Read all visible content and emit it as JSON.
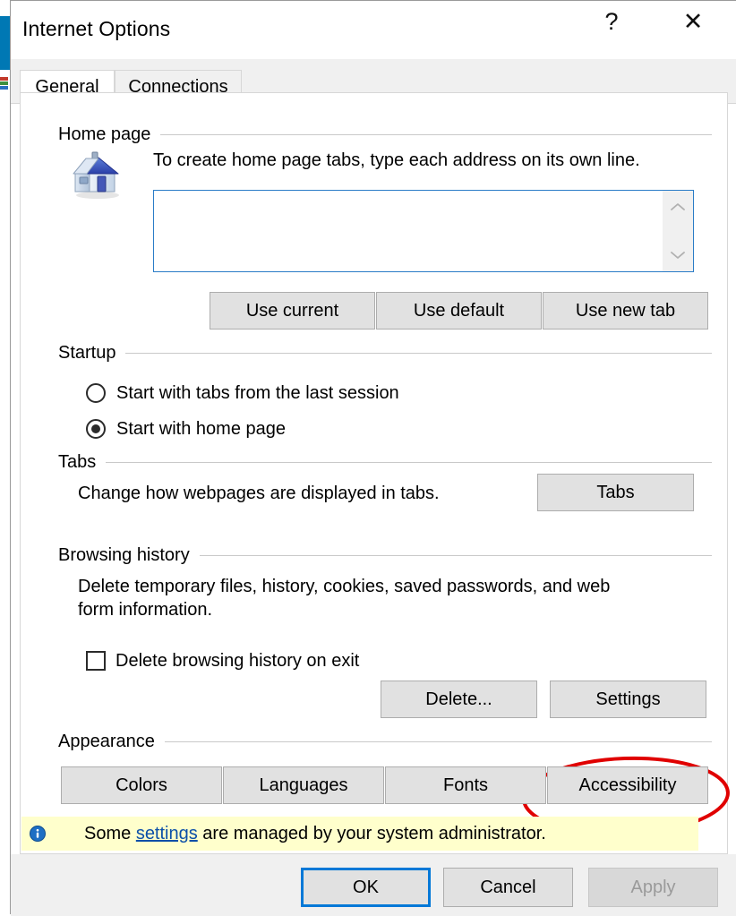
{
  "window": {
    "title": "Internet Options",
    "help_glyph": "?",
    "close_glyph": "✕"
  },
  "tabs": [
    {
      "id": "general",
      "label": "General",
      "active": true
    },
    {
      "id": "connections",
      "label": "Connections",
      "active": false
    }
  ],
  "sections": {
    "home_page": {
      "title": "Home page",
      "description": "To create home page tabs, type each address on its own line.",
      "textarea_value": "",
      "textarea_placeholder": "",
      "buttons": [
        {
          "id": "use-current",
          "label": "Use current"
        },
        {
          "id": "use-default",
          "label": "Use default"
        },
        {
          "id": "use-new-tab",
          "label": "Use new tab"
        }
      ]
    },
    "startup": {
      "title": "Startup",
      "options": [
        {
          "id": "tabs-last-session",
          "label": "Start with tabs from the last session",
          "selected": false
        },
        {
          "id": "home-page",
          "label": "Start with home page",
          "selected": true
        }
      ]
    },
    "tabs_section": {
      "title": "Tabs",
      "description": "Change how webpages are displayed in tabs.",
      "button_label": "Tabs"
    },
    "browsing_history": {
      "title": "Browsing history",
      "description": "Delete temporary files, history, cookies, saved passwords, and web form information.",
      "checkbox_label": "Delete browsing history on exit",
      "checkbox_checked": false,
      "buttons": [
        {
          "id": "delete",
          "label": "Delete..."
        },
        {
          "id": "settings",
          "label": "Settings"
        }
      ]
    },
    "appearance": {
      "title": "Appearance",
      "buttons": [
        {
          "id": "colors",
          "label": "Colors"
        },
        {
          "id": "languages",
          "label": "Languages"
        },
        {
          "id": "fonts",
          "label": "Fonts"
        },
        {
          "id": "accessibility",
          "label": "Accessibility"
        }
      ]
    }
  },
  "admin_notice": {
    "text_before": "Some ",
    "link_text": "settings",
    "text_after": " are managed by your system administrator."
  },
  "footer": {
    "ok_label": "OK",
    "cancel_label": "Cancel",
    "apply_label": "Apply",
    "apply_disabled": true
  },
  "annotation": {
    "target": "settings",
    "shape": "ellipse",
    "color": "#e00000"
  },
  "colors": {
    "accent": "#0078d7",
    "info_bar_background": "#ffffcc",
    "link": "#0b4fa8",
    "annotation_red": "#e00000",
    "button_face": "#e1e1e1",
    "dialog_face": "#f0f0f0"
  }
}
